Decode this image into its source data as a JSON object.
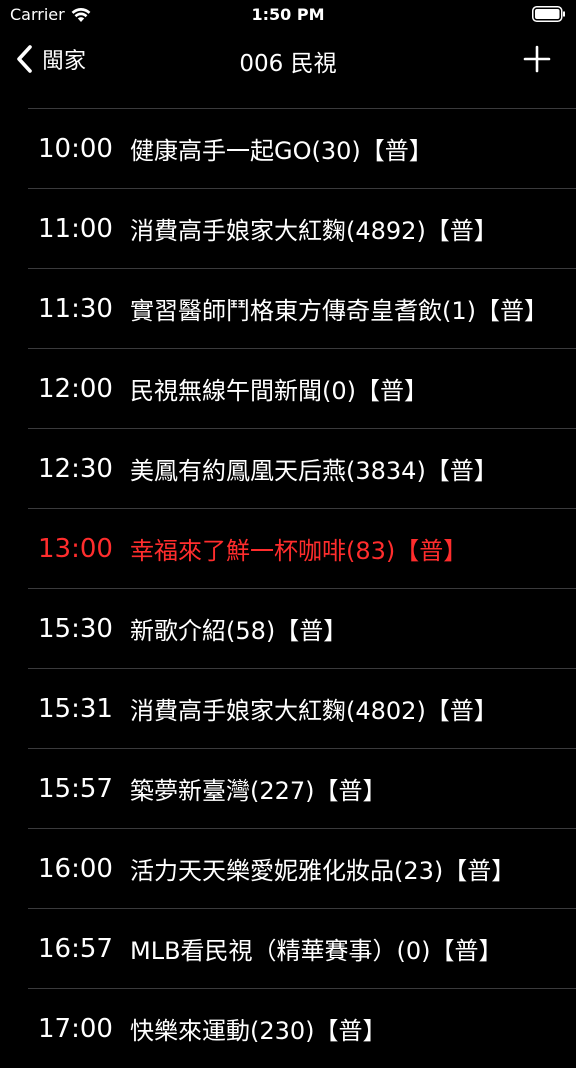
{
  "status": {
    "carrier": "Carrier",
    "time": "1:50 PM"
  },
  "nav": {
    "back_label": "閩家",
    "title": "006 民視"
  },
  "colors": {
    "background": "#000000",
    "text": "#ffffff",
    "highlight": "#ff2d2d",
    "separator": "#3a3a3c"
  },
  "programs": [
    {
      "time": "10:00",
      "title": "健康高手一起GO(30)【普】"
    },
    {
      "time": "11:00",
      "title": "消費高手娘家大紅麴(4892)【普】"
    },
    {
      "time": "11:30",
      "title": "實習醫師鬥格東方傳奇皇耆飲(1)【普】"
    },
    {
      "time": "12:00",
      "title": "民視無線午間新聞(0)【普】"
    },
    {
      "time": "12:30",
      "title": "美鳳有約鳳凰天后燕(3834)【普】"
    },
    {
      "time": "13:00",
      "title": "幸福來了鮮一杯咖啡(83)【普】"
    },
    {
      "time": "15:30",
      "title": "新歌介紹(58)【普】"
    },
    {
      "time": "15:31",
      "title": "消費高手娘家大紅麴(4802)【普】"
    },
    {
      "time": "15:57",
      "title": "築夢新臺灣(227)【普】"
    },
    {
      "time": "16:00",
      "title": "活力天天樂愛妮雅化妝品(23)【普】"
    },
    {
      "time": "16:57",
      "title": "MLB看民視（精華賽事）(0)【普】"
    },
    {
      "time": "17:00",
      "title": "快樂來運動(230)【普】"
    }
  ]
}
